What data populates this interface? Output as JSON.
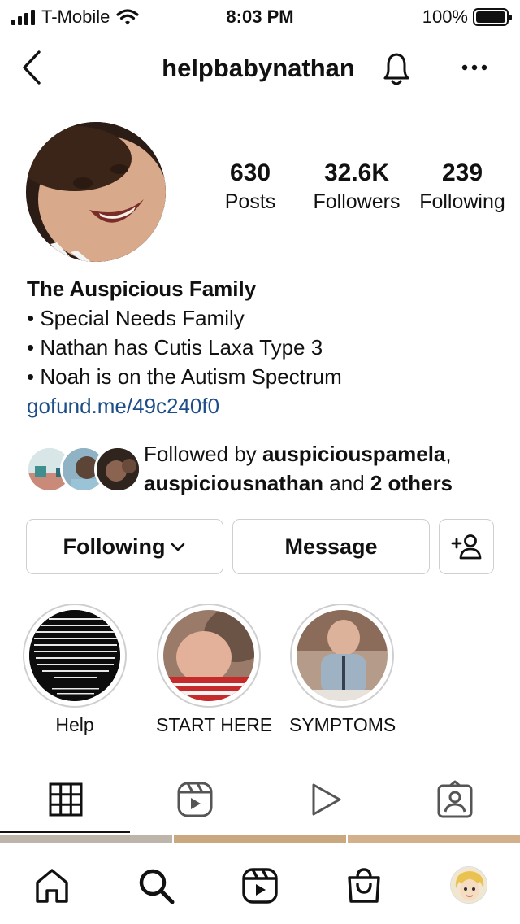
{
  "status_bar": {
    "carrier": "T-Mobile",
    "time": "8:03 PM",
    "battery": "100%"
  },
  "header": {
    "username": "helpbabynathan"
  },
  "profile": {
    "stats": [
      {
        "value": "630",
        "label": "Posts"
      },
      {
        "value": "32.6K",
        "label": "Followers"
      },
      {
        "value": "239",
        "label": "Following"
      }
    ],
    "name": "The Auspicious Family",
    "bio_lines": [
      "• Special Needs Family",
      "• Nathan has Cutis Laxa Type 3",
      "• Noah is on the Autism Spectrum"
    ],
    "link": "gofund.me/49c240f0"
  },
  "followed_by": {
    "prefix": "Followed by ",
    "user1": "auspiciouspamela",
    "comma": ",",
    "user2": "auspiciousnathan",
    "and": " and ",
    "others": "2 others"
  },
  "actions": {
    "following_label": "Following",
    "message_label": "Message"
  },
  "highlights": [
    {
      "label": "Help"
    },
    {
      "label": "START HERE"
    },
    {
      "label": "SYMPTOMS"
    }
  ],
  "colors": {
    "link": "#1d4e89",
    "border": "#cfcfcf"
  }
}
